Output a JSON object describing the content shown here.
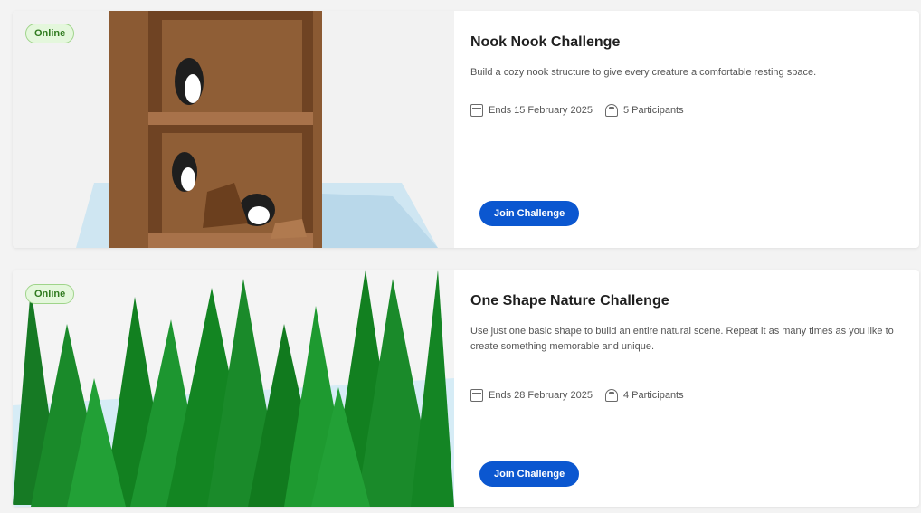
{
  "challenges": [
    {
      "badge": "Online",
      "title": "Nook Nook Challenge",
      "description": "Build a cozy nook structure to give every creature a comfortable resting space.",
      "date": "Ends 15 February 2025",
      "participants": "5 Participants",
      "button": "Join Challenge"
    },
    {
      "badge": "Online",
      "title": "One Shape Nature Challenge",
      "description": "Use just one basic shape to build an entire natural scene. Repeat it as many times as you like to create something memorable and unique.",
      "date": "Ends 28 February 2025",
      "participants": "4 Participants",
      "button": "Join Challenge"
    }
  ],
  "colors": {
    "accent": "#0b57d0",
    "badge_bg": "#e4f7dc",
    "badge_text": "#2f7a1e",
    "tree_green": "#1a8a2a",
    "trunk_brown": "#7a4a2a"
  },
  "icons": {
    "date": "calendar-icon",
    "participants": "people-icon"
  }
}
